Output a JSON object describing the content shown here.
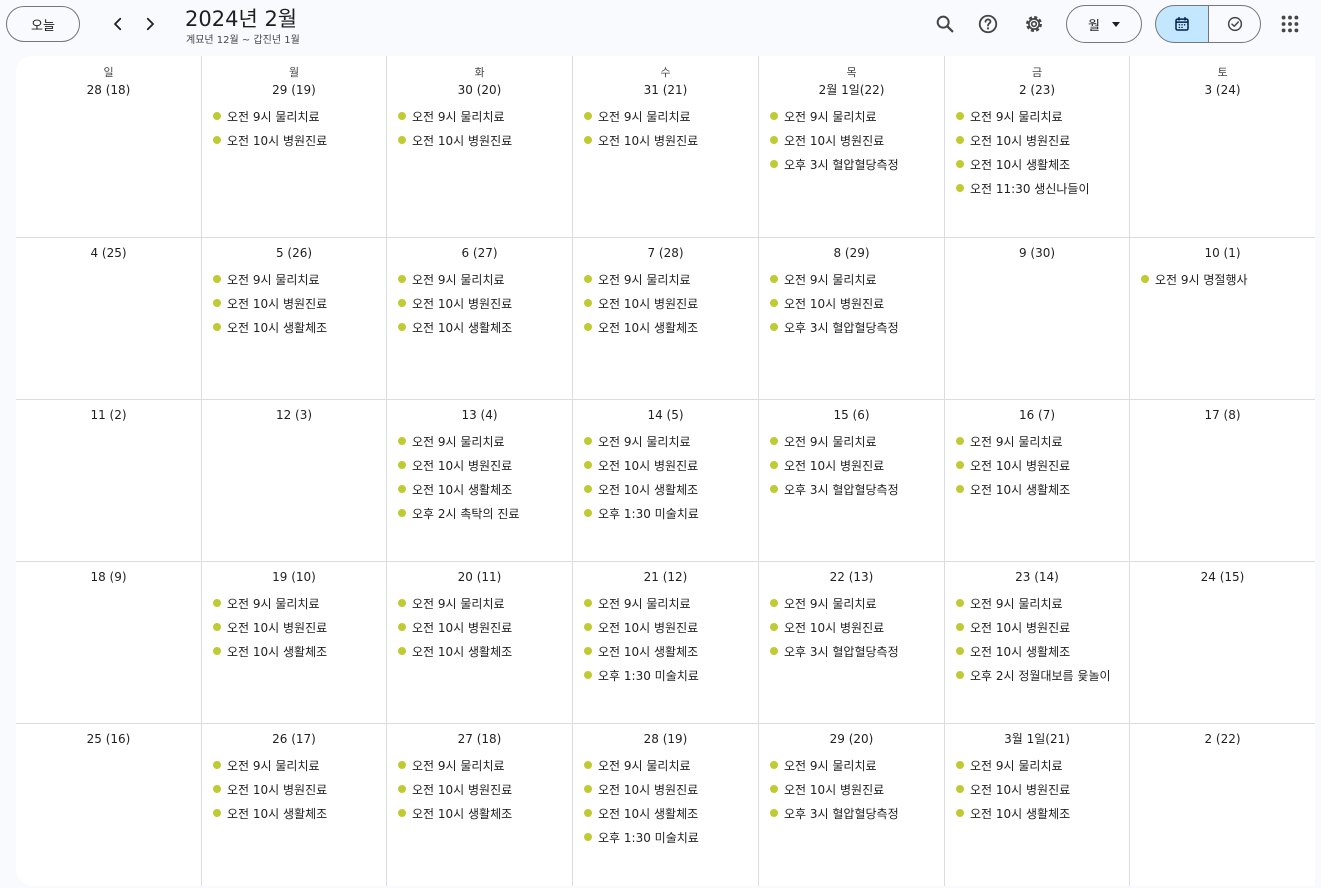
{
  "header": {
    "today_label": "오늘",
    "title": "2024년 2월",
    "subtitle": "계묘년 12월 ~ 갑진년 1월",
    "view_label": "월"
  },
  "icons": [
    "chevron-left-icon",
    "chevron-right-icon",
    "search-icon",
    "help-icon",
    "settings-icon",
    "calendar-icon",
    "tasks-check-icon",
    "apps-grid-icon"
  ],
  "colors": {
    "event_dot": "#c0ca33",
    "accent": "#c2e7ff"
  },
  "weekdays": [
    "일",
    "월",
    "화",
    "수",
    "목",
    "금",
    "토"
  ],
  "weeks": [
    [
      {
        "date": "28 (18)",
        "events": []
      },
      {
        "date": "29 (19)",
        "events": [
          "오전 9시 물리치료",
          "오전 10시 병원진료"
        ]
      },
      {
        "date": "30 (20)",
        "events": [
          "오전 9시 물리치료",
          "오전 10시 병원진료"
        ]
      },
      {
        "date": "31 (21)",
        "events": [
          "오전 9시 물리치료",
          "오전 10시 병원진료"
        ]
      },
      {
        "date": "2월 1일(22)",
        "events": [
          "오전 9시 물리치료",
          "오전 10시 병원진료",
          "오후 3시 혈압혈당측정"
        ]
      },
      {
        "date": "2 (23)",
        "events": [
          "오전 9시 물리치료",
          "오전 10시 병원진료",
          "오전 10시 생활체조",
          "오전 11:30 생신나들이"
        ]
      },
      {
        "date": "3 (24)",
        "events": []
      }
    ],
    [
      {
        "date": "4 (25)",
        "events": []
      },
      {
        "date": "5 (26)",
        "events": [
          "오전 9시 물리치료",
          "오전 10시 병원진료",
          "오전 10시 생활체조"
        ]
      },
      {
        "date": "6 (27)",
        "events": [
          "오전 9시 물리치료",
          "오전 10시 병원진료",
          "오전 10시 생활체조"
        ]
      },
      {
        "date": "7 (28)",
        "events": [
          "오전 9시 물리치료",
          "오전 10시 병원진료",
          "오전 10시 생활체조"
        ]
      },
      {
        "date": "8 (29)",
        "events": [
          "오전 9시 물리치료",
          "오전 10시 병원진료",
          "오후 3시 혈압혈당측정"
        ]
      },
      {
        "date": "9 (30)",
        "events": []
      },
      {
        "date": "10 (1)",
        "events": [
          "오전 9시 명절행사"
        ]
      }
    ],
    [
      {
        "date": "11 (2)",
        "events": []
      },
      {
        "date": "12 (3)",
        "events": []
      },
      {
        "date": "13 (4)",
        "events": [
          "오전 9시 물리치료",
          "오전 10시 병원진료",
          "오전 10시 생활체조",
          "오후 2시 촉탁의 진료"
        ]
      },
      {
        "date": "14 (5)",
        "events": [
          "오전 9시 물리치료",
          "오전 10시 병원진료",
          "오전 10시 생활체조",
          "오후 1:30 미술치료"
        ]
      },
      {
        "date": "15 (6)",
        "events": [
          "오전 9시 물리치료",
          "오전 10시 병원진료",
          "오후 3시 혈압혈당측정"
        ]
      },
      {
        "date": "16 (7)",
        "events": [
          "오전 9시 물리치료",
          "오전 10시 병원진료",
          "오전 10시 생활체조"
        ]
      },
      {
        "date": "17 (8)",
        "events": []
      }
    ],
    [
      {
        "date": "18 (9)",
        "events": []
      },
      {
        "date": "19 (10)",
        "events": [
          "오전 9시 물리치료",
          "오전 10시 병원진료",
          "오전 10시 생활체조"
        ]
      },
      {
        "date": "20 (11)",
        "events": [
          "오전 9시 물리치료",
          "오전 10시 병원진료",
          "오전 10시 생활체조"
        ]
      },
      {
        "date": "21 (12)",
        "events": [
          "오전 9시 물리치료",
          "오전 10시 병원진료",
          "오전 10시 생활체조",
          "오후 1:30 미술치료"
        ]
      },
      {
        "date": "22 (13)",
        "events": [
          "오전 9시 물리치료",
          "오전 10시 병원진료",
          "오후 3시 혈압혈당측정"
        ]
      },
      {
        "date": "23 (14)",
        "events": [
          "오전 9시 물리치료",
          "오전 10시 병원진료",
          "오전 10시 생활체조",
          "오후 2시 정월대보름 윷놀이"
        ]
      },
      {
        "date": "24 (15)",
        "events": []
      }
    ],
    [
      {
        "date": "25 (16)",
        "events": []
      },
      {
        "date": "26 (17)",
        "events": [
          "오전 9시 물리치료",
          "오전 10시 병원진료",
          "오전 10시 생활체조"
        ]
      },
      {
        "date": "27 (18)",
        "events": [
          "오전 9시 물리치료",
          "오전 10시 병원진료",
          "오전 10시 생활체조"
        ]
      },
      {
        "date": "28 (19)",
        "events": [
          "오전 9시 물리치료",
          "오전 10시 병원진료",
          "오전 10시 생활체조",
          "오후 1:30 미술치료"
        ]
      },
      {
        "date": "29 (20)",
        "events": [
          "오전 9시 물리치료",
          "오전 10시 병원진료",
          "오후 3시 혈압혈당측정"
        ]
      },
      {
        "date": "3월 1일(21)",
        "events": [
          "오전 9시 물리치료",
          "오전 10시 병원진료",
          "오전 10시 생활체조"
        ]
      },
      {
        "date": "2 (22)",
        "events": []
      }
    ]
  ]
}
